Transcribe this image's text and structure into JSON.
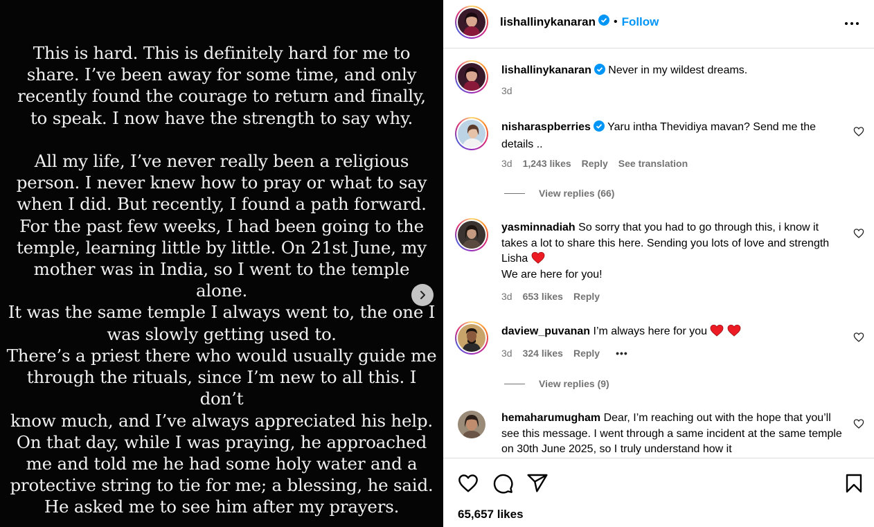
{
  "media": {
    "paragraphs": [
      [
        "This is hard. This is definitely hard for me to",
        "share. I’ve been away for some time, and only",
        "recently found the courage to return and finally,",
        "to speak. I now have the strength to say why."
      ],
      [
        "All my life, I’ve never really been a religious",
        "person. I never knew how to pray or what to say",
        "when I did. But recently, I found a path forward.",
        "For the past few weeks, I had been going to the",
        "temple, learning little by little. On 21st June, my",
        "mother was in India, so I went to the temple alone.",
        "It was the same temple I always went to, the one I",
        "was slowly getting used to."
      ],
      [
        "There’s a priest there who would usually guide me",
        "through the rituals, since I’m new to all this. I don’t",
        "know much, and I’ve always appreciated his help.",
        "On that day, while I was praying, he approached",
        "me and told me he had some holy water and a",
        "protective string to tie for me; a blessing, he said.",
        "He asked me to see him after my prayers."
      ]
    ],
    "next_icon": "chevron-right-icon"
  },
  "header": {
    "username": "lishallinykanaran",
    "follow_label": "Follow",
    "separator": "•",
    "more_icon": "more-horizontal-icon"
  },
  "caption": {
    "username": "lishallinykanaran",
    "text": "Never in my wildest dreams.",
    "time": "3d"
  },
  "comments": [
    {
      "username": "nisharaspberries",
      "verified": true,
      "text": "Yaru intha Thevidiya mavan? Send me the details ..",
      "time": "3d",
      "likes": "1,243 likes",
      "reply": "Reply",
      "translate": "See translation",
      "view_replies": "View replies (66)"
    },
    {
      "username": "yasminnadiah",
      "verified": false,
      "text": "So sorry that you had to go through this, i know it takes a lot to share this here. Sending you lots of love and strength Lisha",
      "text_line2": "We are here for you!",
      "time": "3d",
      "likes": "653 likes",
      "reply": "Reply"
    },
    {
      "username": "daview_puvanan",
      "verified": false,
      "text": "I’m always here for you",
      "time": "3d",
      "likes": "324 likes",
      "reply": "Reply",
      "more": "•••",
      "view_replies": "View replies (9)"
    },
    {
      "username": "hemaharumugham",
      "verified": false,
      "text": "Dear, I’m reaching out with the hope that you’ll see this message. I went through a same incident at the same temple on 30th June 2025, so I truly understand how it"
    }
  ],
  "actions": {
    "like_icon": "heart-icon",
    "comment_icon": "comment-icon",
    "share_icon": "share-icon",
    "save_icon": "bookmark-icon",
    "likes": "65,657 likes"
  },
  "colors": {
    "accent": "#0095f6",
    "muted": "#737373",
    "heart": "#ed1c24"
  }
}
